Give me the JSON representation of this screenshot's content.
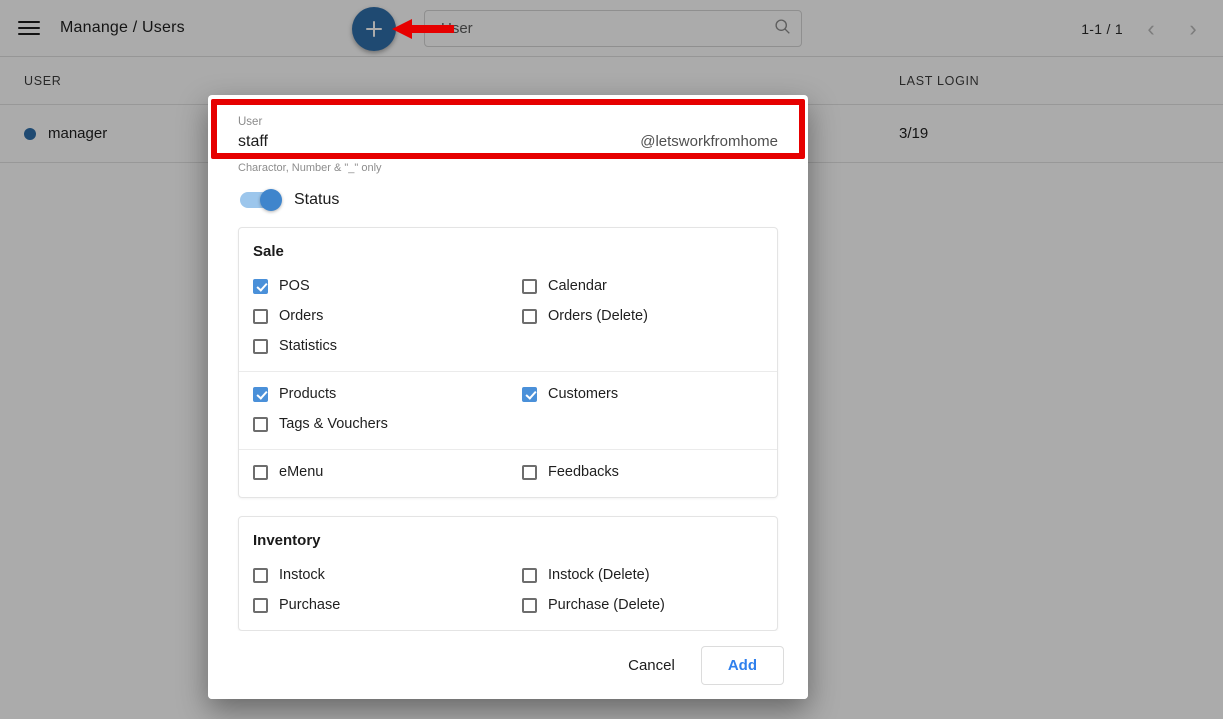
{
  "header": {
    "menu_icon": "hamburger-menu-icon",
    "title": "Manange / Users",
    "fab_icon": "plus-icon",
    "search": {
      "placeholder": "User",
      "value": "",
      "icon": "search-icon"
    },
    "pagination": {
      "count": "1-1 / 1",
      "prev_icon": "chevron-left-icon",
      "next_icon": "chevron-right-icon"
    }
  },
  "table": {
    "columns": [
      "USER",
      "LAST LOGIN"
    ],
    "rows": [
      {
        "status_dot": "#2f6fab",
        "user": "manager",
        "last_login": "3/19"
      }
    ]
  },
  "dialog": {
    "user_field": {
      "label": "User",
      "value": "staff",
      "suffix": "@letsworkfromhome",
      "hint": "Charactor, Number & \"_\" only"
    },
    "status": {
      "label": "Status",
      "enabled": true
    },
    "permission_cards": [
      {
        "title": "Sale",
        "groups": [
          {
            "items": [
              {
                "label": "POS",
                "checked": true
              },
              {
                "label": "Calendar",
                "checked": false
              },
              {
                "label": "Orders",
                "checked": false
              },
              {
                "label": "Orders (Delete)",
                "checked": false
              },
              {
                "label": "Statistics",
                "checked": false
              }
            ]
          },
          {
            "items": [
              {
                "label": "Products",
                "checked": true
              },
              {
                "label": "Customers",
                "checked": true
              },
              {
                "label": "Tags & Vouchers",
                "checked": false
              }
            ]
          },
          {
            "items": [
              {
                "label": "eMenu",
                "checked": false
              },
              {
                "label": "Feedbacks",
                "checked": false
              }
            ]
          }
        ]
      },
      {
        "title": "Inventory",
        "groups": [
          {
            "items": [
              {
                "label": "Instock",
                "checked": false
              },
              {
                "label": "Instock (Delete)",
                "checked": false
              },
              {
                "label": "Purchase",
                "checked": false
              },
              {
                "label": "Purchase (Delete)",
                "checked": false
              }
            ]
          }
        ]
      }
    ],
    "footer": {
      "cancel_label": "Cancel",
      "add_label": "Add"
    }
  },
  "annotations": {
    "highlight_color": "#e60000",
    "arrow_color": "#e60000"
  },
  "colors": {
    "accent_blue": "#2f6fab",
    "checkbox_blue": "#4a90d9",
    "link_blue": "#2f80ed"
  }
}
